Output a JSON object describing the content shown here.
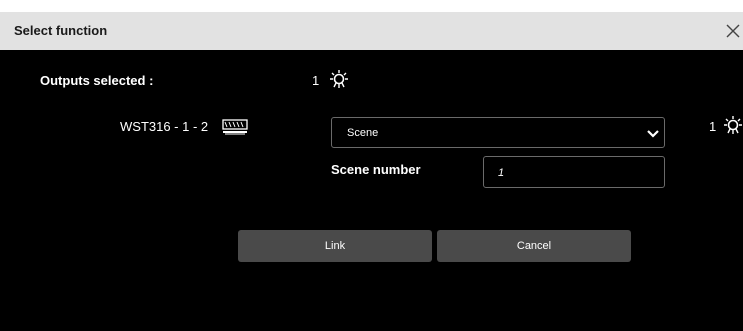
{
  "dialog": {
    "title": "Select function",
    "close_icon": "close-icon"
  },
  "outputs": {
    "label": "Outputs selected :",
    "count": "1",
    "icon": "bulb-icon"
  },
  "device": {
    "name": "WST316 - 1 - 2",
    "icon": "wall-switch-icon"
  },
  "function_select": {
    "value": "Scene",
    "icon": "chevron-down-icon"
  },
  "right_count": {
    "count": "1",
    "icon": "bulb-icon"
  },
  "scene_number": {
    "label": "Scene number",
    "value": "1"
  },
  "buttons": {
    "link": "Link",
    "cancel": "Cancel"
  },
  "colors": {
    "background": "#000000",
    "titlebar": "#e2e2e2",
    "button": "#4a4a4a"
  }
}
